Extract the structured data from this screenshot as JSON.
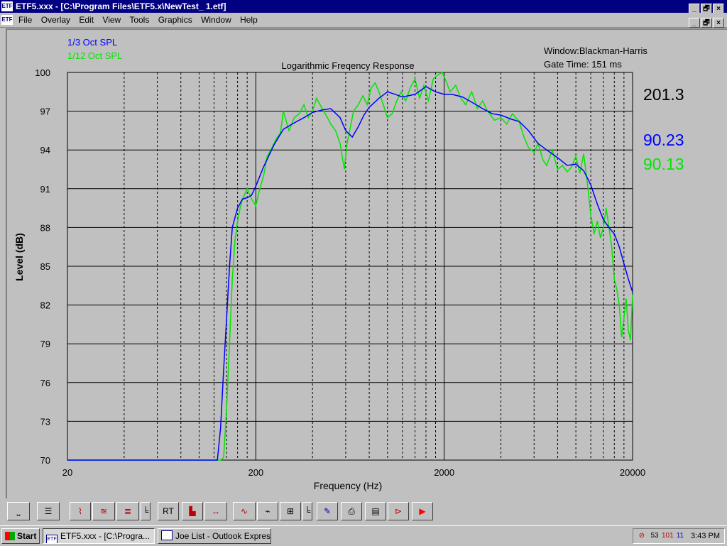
{
  "window": {
    "title": "ETF5.xxx - [C:\\Program Files\\ETF5.x\\NewTest_ 1.etf]",
    "app_icon_label": "ETF",
    "buttons": [
      "_",
      "🗗",
      "×"
    ]
  },
  "menubar": {
    "items": [
      "File",
      "Overlay",
      "Edit",
      "View",
      "Tools",
      "Graphics",
      "Window",
      "Help"
    ]
  },
  "chart_data": {
    "type": "line",
    "title": "Logarithmic Freqency Response",
    "xlabel": "Frequency (Hz)",
    "ylabel": "Level (dB)",
    "xscale": "log",
    "xlim": [
      20,
      20000
    ],
    "ylim": [
      70,
      100
    ],
    "x_tick_labels": [
      "20",
      "200",
      "2000",
      "20000"
    ],
    "x_ticks": [
      20,
      200,
      2000,
      20000
    ],
    "y_ticks": [
      70,
      73,
      76,
      79,
      82,
      85,
      88,
      91,
      94,
      97,
      100
    ],
    "grid": true,
    "legend_position": "top-left",
    "info_window": "Window:Blackman-Harris",
    "info_gate": "Gate Time: 151 ms",
    "readout_main": "201.3",
    "readout_series1": "90.23",
    "readout_series2": "90.13",
    "series": [
      {
        "name": "1/3 Oct SPL",
        "color": "#0000ff",
        "x": [
          20,
          100,
          125,
          130,
          135,
          140,
          145,
          150,
          160,
          170,
          180,
          190,
          200,
          220,
          250,
          280,
          320,
          360,
          400,
          450,
          500,
          560,
          600,
          650,
          700,
          750,
          800,
          900,
          1000,
          1100,
          1200,
          1400,
          1600,
          1800,
          2000,
          2200,
          2500,
          2800,
          3200,
          3600,
          4000,
          4500,
          5000,
          5600,
          6300,
          7000,
          8000,
          9000,
          10000,
          11000,
          12000,
          13000,
          14000,
          15000,
          16000,
          17000,
          18000,
          19000,
          20000
        ],
        "y": [
          70,
          70,
          70,
          72.5,
          77,
          81,
          85,
          88,
          89.5,
          90.2,
          90.3,
          90.5,
          91.2,
          92.7,
          94.4,
          95.6,
          96.1,
          96.5,
          96.9,
          97.1,
          97.2,
          96.5,
          95.5,
          95.0,
          95.8,
          96.7,
          97.3,
          98.0,
          98.5,
          98.3,
          98.1,
          98.3,
          98.9,
          98.5,
          98.3,
          98.3,
          98.1,
          97.7,
          97.2,
          96.8,
          96.7,
          96.4,
          96.2,
          95.5,
          94.5,
          94.0,
          93.4,
          92.8,
          92.9,
          92.4,
          91.3,
          89.8,
          88.6,
          88.0,
          87.5,
          86.5,
          85.2,
          84.0,
          83.0
        ]
      },
      {
        "name": "1/12 Oct SPL",
        "color": "#00e600",
        "x": [
          20,
          100,
          130,
          135,
          140,
          145,
          150,
          155,
          160,
          165,
          170,
          180,
          190,
          200,
          210,
          220,
          230,
          240,
          250,
          260,
          270,
          280,
          300,
          320,
          340,
          360,
          380,
          400,
          420,
          450,
          480,
          500,
          530,
          560,
          590,
          610,
          630,
          660,
          700,
          740,
          780,
          820,
          860,
          900,
          950,
          1000,
          1060,
          1120,
          1180,
          1250,
          1320,
          1400,
          1480,
          1560,
          1650,
          1750,
          1850,
          1950,
          2050,
          2150,
          2300,
          2450,
          2600,
          2800,
          3000,
          3200,
          3400,
          3700,
          4000,
          4300,
          4600,
          5000,
          5300,
          5600,
          6000,
          6300,
          6700,
          7000,
          7500,
          8000,
          8500,
          9000,
          9500,
          10000,
          10500,
          11000,
          11500,
          12000,
          12500,
          13000,
          13500,
          14000,
          14500,
          15000,
          15500,
          16000,
          16500,
          17000,
          17500,
          18000,
          18500,
          19000,
          19500,
          20000
        ],
        "y": [
          70,
          70,
          70,
          70.2,
          74,
          79,
          84,
          87,
          88.5,
          89.5,
          90.2,
          91.0,
          90.2,
          89.7,
          91.0,
          92.0,
          93.5,
          94.0,
          94.5,
          95.0,
          95.3,
          97.0,
          95.5,
          96.5,
          96.8,
          97.5,
          96.5,
          97.0,
          98.0,
          97.2,
          96.5,
          96.0,
          95.5,
          94.5,
          92.5,
          94.5,
          95.5,
          97.0,
          97.5,
          98.2,
          97.5,
          98.8,
          99.2,
          98.5,
          97.5,
          96.5,
          96.8,
          97.8,
          98.5,
          97.8,
          98.8,
          99.5,
          98.0,
          99.0,
          97.8,
          99.5,
          99.8,
          100.0,
          99.3,
          98.5,
          99.0,
          98.0,
          97.5,
          98.5,
          97.2,
          97.8,
          97.0,
          96.3,
          96.5,
          96.0,
          96.8,
          96.2,
          95.0,
          94.2,
          93.8,
          94.5,
          93.2,
          92.8,
          94.0,
          92.5,
          92.8,
          92.3,
          92.7,
          93.5,
          92.2,
          93.7,
          91.5,
          89.0,
          87.5,
          88.5,
          87.2,
          88.0,
          89.5,
          88.0,
          86.5,
          84.0,
          83.2,
          82.0,
          79.5,
          81.0,
          82.5,
          80.0,
          79.3,
          82.8
        ]
      }
    ]
  },
  "toolbar": {
    "buttons": [
      {
        "name": "pan-tool-button",
        "glyph": "⎵",
        "color": "#000"
      },
      {
        "name": "slider-tool-button",
        "glyph": "☰",
        "color": "#000"
      },
      {
        "name": "waveform-button",
        "glyph": "⌇",
        "color": "#c00000"
      },
      {
        "name": "spectrum-button",
        "glyph": "≋",
        "color": "#c00000"
      },
      {
        "name": "waterfall-button",
        "glyph": "≣",
        "color": "#c00000"
      },
      {
        "name": "marker-button",
        "glyph": "╘",
        "color": "#000"
      },
      {
        "name": "rt-button",
        "glyph": "RT",
        "color": "#000"
      },
      {
        "name": "decay-button",
        "glyph": "▙",
        "color": "#c00000"
      },
      {
        "name": "range-button",
        "glyph": "↔",
        "color": "#c00000"
      },
      {
        "name": "response-button",
        "glyph": "∿",
        "color": "#c00000"
      },
      {
        "name": "phase-button",
        "glyph": "⌁",
        "color": "#000"
      },
      {
        "name": "filter-button",
        "glyph": "⊞",
        "color": "#000"
      },
      {
        "name": "bracket-button",
        "glyph": "╘",
        "color": "#000"
      },
      {
        "name": "color-pick-button",
        "glyph": "✎",
        "color": "#0000c0"
      },
      {
        "name": "print-button",
        "glyph": "⎙",
        "color": "#000"
      },
      {
        "name": "notes-button",
        "glyph": "▤",
        "color": "#000"
      },
      {
        "name": "signal-button",
        "glyph": "⊳",
        "color": "#c00000"
      },
      {
        "name": "run-button",
        "glyph": "▶",
        "color": "#ff0000"
      }
    ]
  },
  "taskbar": {
    "start_label": "Start",
    "tasks": [
      {
        "label": "ETF5.xxx - [C:\\Progra...",
        "active": true
      },
      {
        "label": "Joe List - Outlook Express",
        "active": false
      }
    ],
    "tray_icons": [
      "⊘",
      "53",
      "101",
      "11"
    ],
    "clock": "3:43 PM"
  }
}
